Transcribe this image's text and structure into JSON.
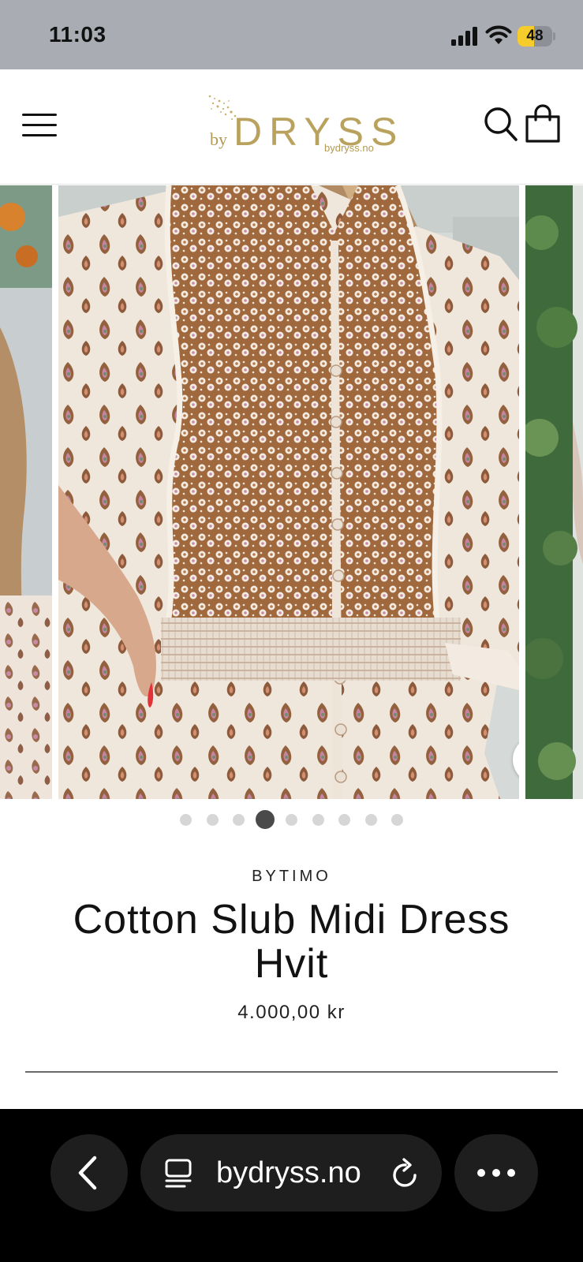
{
  "status_bar": {
    "time": "11:03",
    "battery_level": "48",
    "battery_fraction": 0.48
  },
  "header": {
    "logo_prefix": "by",
    "logo_word": "DRYSS",
    "logo_url": "bydryss.no",
    "menu_icon": "hamburger-icon",
    "search_icon": "search-icon",
    "cart_icon": "shopping-bag-icon"
  },
  "gallery": {
    "image_count": 9,
    "active_index": 3,
    "zoom_icon": "magnifier-icon"
  },
  "product": {
    "brand": "BYTIMO",
    "title_line1": "Cotton Slub Midi Dress",
    "title_line2": "Hvit",
    "price": "4.000,00 kr"
  },
  "browser": {
    "url": "bydryss.no",
    "back_icon": "chevron-left-icon",
    "tabs_icon": "page-menu-icon",
    "reload_icon": "reload-icon",
    "more_icon": "ellipsis-icon"
  },
  "colors": {
    "status_bar_bg": "#a9acb3",
    "logo_gold": "#b9a25d",
    "battery_yellow": "#f5cc2c",
    "browser_bar_bg": "#000000"
  }
}
